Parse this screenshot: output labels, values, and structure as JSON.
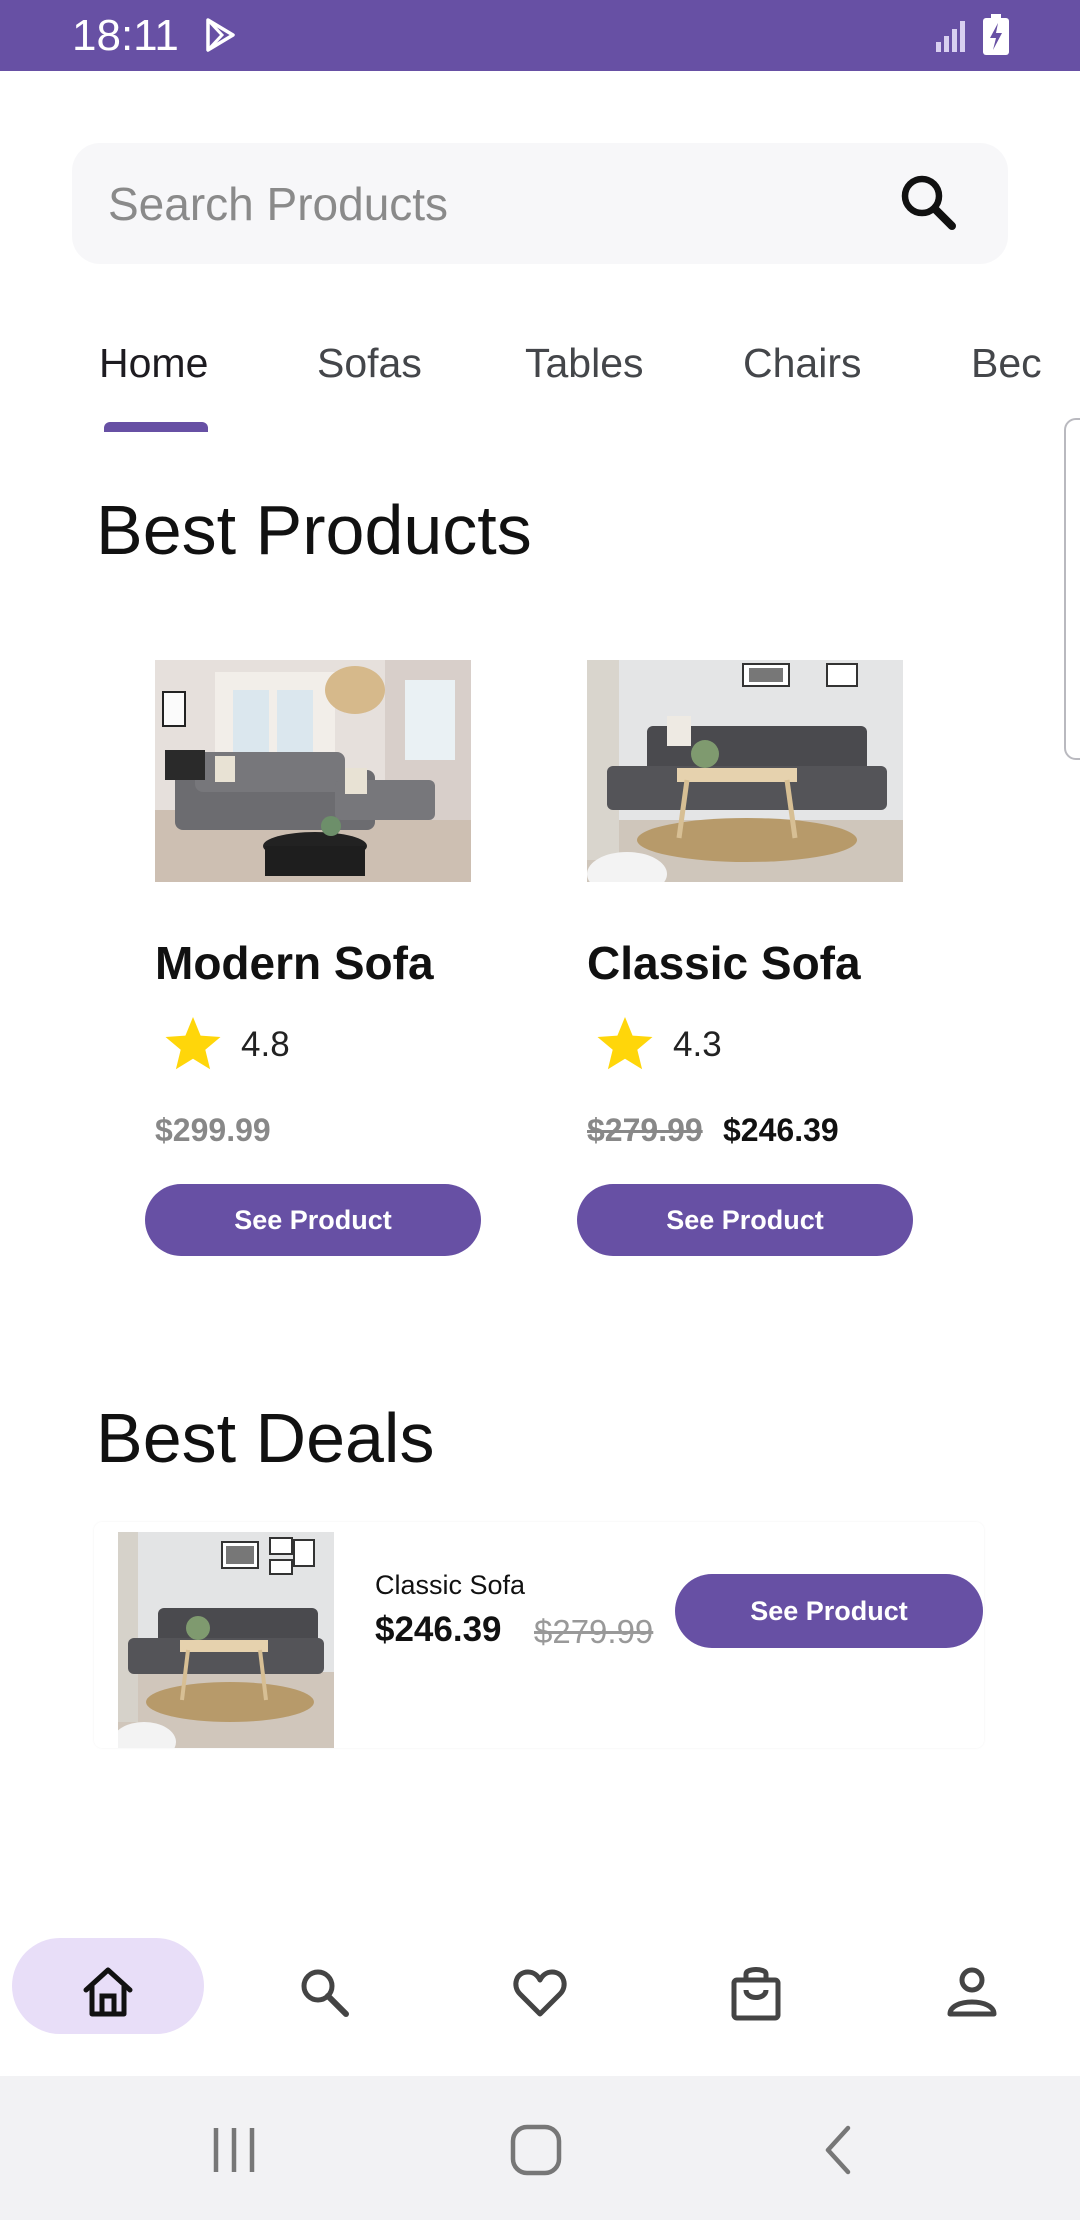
{
  "status_bar": {
    "time": "18:11",
    "icons": [
      "play-store-icon",
      "signal-icon",
      "battery-charging-icon"
    ],
    "background": "#6750a4"
  },
  "search": {
    "placeholder": "Search Products",
    "icon": "search-icon"
  },
  "tabs": [
    {
      "label": "Home",
      "active": true
    },
    {
      "label": "Sofas",
      "active": false
    },
    {
      "label": "Tables",
      "active": false
    },
    {
      "label": "Chairs",
      "active": false
    },
    {
      "label": "Bec",
      "active": false
    }
  ],
  "best_products": {
    "title": "Best Products",
    "items": [
      {
        "name": "Modern Sofa",
        "rating": "4.8",
        "price": "$299.99",
        "button_label": "See Product"
      },
      {
        "name": "Classic Sofa",
        "rating": "4.3",
        "old_price": "$279.99",
        "price": "$246.39",
        "button_label": "See Product"
      }
    ]
  },
  "best_deals": {
    "title": "Best Deals",
    "items": [
      {
        "name": "Classic Sofa",
        "price": "$246.39",
        "old_price": "$279.99",
        "button_label": "See Product"
      }
    ]
  },
  "bottom_nav": {
    "items": [
      "home-icon",
      "search-icon",
      "heart-icon",
      "shopping-bag-icon",
      "profile-icon"
    ],
    "active": "home-icon"
  },
  "system_nav": {
    "items": [
      "recent-apps-icon",
      "home-button-icon",
      "back-icon"
    ]
  },
  "colors": {
    "accent": "#6750a4",
    "nav_pill": "#e8def8",
    "star": "#ffd60a"
  }
}
